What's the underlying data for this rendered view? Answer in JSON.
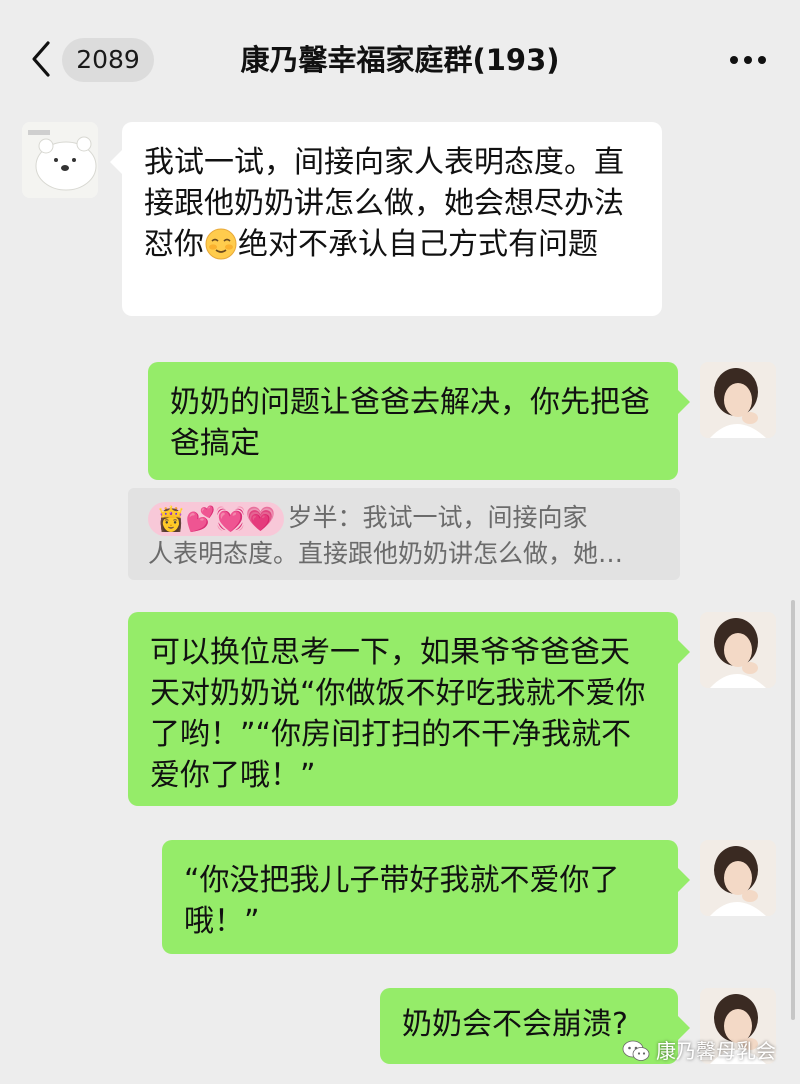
{
  "header": {
    "back_icon": "chevron-left-icon",
    "unread_count": "2089",
    "title": "康乃馨幸福家庭群(193)",
    "more_icon": "more-dots-icon"
  },
  "messages": [
    {
      "side": "left",
      "avatar": "polar-bear-avatar",
      "parts": [
        "我试一试，间接向家人表明态度。直接跟他奶奶讲怎么做，她会想尽办法怼你",
        "绝对不承认自己方式有问题"
      ],
      "emoji": "blushing-face-icon"
    },
    {
      "side": "right",
      "avatar": "woman-avatar",
      "text": "奶奶的问题让爸爸去解决，你先把爸爸搞定"
    },
    {
      "side": "right",
      "avatar": "woman-avatar",
      "text": "可以换位思考一下，如果爷爷爸爸天天对奶奶说“你做饭不好吃我就不爱你了哟！”“你房间打扫的不干净我就不爱你了哦！”"
    },
    {
      "side": "right",
      "avatar": "woman-avatar",
      "text": "“你没把我儿子带好我就不爱你了哦！”"
    },
    {
      "side": "right",
      "avatar": "woman-avatar",
      "text": "奶奶会不会崩溃?"
    }
  ],
  "quote": {
    "sender_emojis": "👸💕💓💗",
    "line1": "岁半：我试一试，间接向家",
    "line2": "人表明态度。直接跟他奶奶讲怎么做，她…"
  },
  "watermark": {
    "icon": "wechat-icon",
    "text": "康乃馨母乳会"
  },
  "colors": {
    "background": "#ededed",
    "bubble_self": "#95ec69",
    "bubble_other": "#ffffff"
  }
}
